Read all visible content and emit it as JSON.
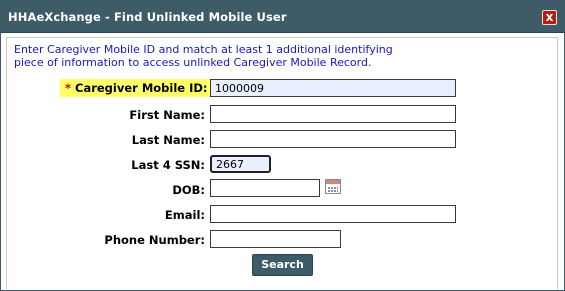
{
  "window": {
    "title": "HHAeXchange - Find Unlinked Mobile User",
    "close_label": "x"
  },
  "instructions": {
    "line1": "Enter Caregiver Mobile ID and match at least 1 additional identifying",
    "line2": "piece of information to access unlinked Caregiver Mobile Record."
  },
  "form": {
    "caregiver_mobile_id": {
      "label": "Caregiver Mobile ID:",
      "required_marker": "*",
      "value": "1000009"
    },
    "first_name": {
      "label": "First Name:",
      "value": ""
    },
    "last_name": {
      "label": "Last Name:",
      "value": ""
    },
    "last4_ssn": {
      "label": "Last 4 SSN:",
      "value": "2667"
    },
    "dob": {
      "label": "DOB:",
      "value": ""
    },
    "email": {
      "label": "Email:",
      "value": ""
    },
    "phone_number": {
      "label": "Phone Number:",
      "value": ""
    }
  },
  "actions": {
    "search_label": "Search"
  },
  "colors": {
    "titlebar": "#3e5c68",
    "instructions_text": "#1717c7",
    "required_highlight": "#ffff66",
    "required_star": "#d00000",
    "close_button": "#b61e14"
  },
  "icons": {
    "dob_picker": "calendar-icon",
    "close": "close-icon"
  }
}
